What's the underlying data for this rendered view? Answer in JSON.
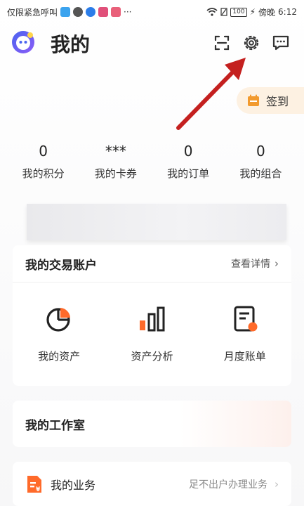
{
  "status_bar": {
    "left_text": "仅限紧急呼叫",
    "more": "···",
    "battery": "100",
    "carrier": "傍晚",
    "time": "6:12"
  },
  "header": {
    "title": "我的",
    "icons": [
      "app-logo-icon",
      "scan-icon",
      "gear-icon",
      "message-icon"
    ]
  },
  "sign_in": {
    "label": "签到"
  },
  "stats": [
    {
      "value": "0",
      "label": "我的积分"
    },
    {
      "value": "***",
      "label": "我的卡券"
    },
    {
      "value": "0",
      "label": "我的订单"
    },
    {
      "value": "0",
      "label": "我的组合"
    }
  ],
  "account_card": {
    "title": "我的交易账户",
    "link": "查看详情",
    "chevron": "›",
    "features": [
      {
        "label": "我的资产",
        "icon": "pie-chart-icon"
      },
      {
        "label": "资产分析",
        "icon": "bar-chart-icon"
      },
      {
        "label": "月度账单",
        "icon": "bill-icon"
      }
    ]
  },
  "studio_card": {
    "title": "我的工作室"
  },
  "business_card": {
    "label": "我的业务",
    "hint": "足不出户办理业务",
    "chevron": "›"
  },
  "colors": {
    "accent_orange": "#ff6a2a",
    "sign_bg": "#fdf1e2",
    "arrow_red": "#c4201f",
    "logo_blue": "#4a63f0",
    "logo_purple": "#8b5cf6"
  }
}
